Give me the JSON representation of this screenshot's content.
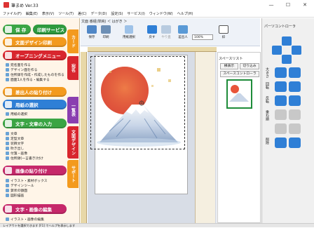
{
  "window": {
    "title": "筆まめ Ver.33",
    "min": "—",
    "max": "☐",
    "close": "✕"
  },
  "menu": [
    "ファイル(F)",
    "編集(E)",
    "表示(V)",
    "ツール(T)",
    "差(C)",
    "データ(D)",
    "設定(S)",
    "サービス(I)",
    "ウィンドウ(W)",
    "ヘルプ(H)"
  ],
  "sidebar": {
    "save_label": "保 存",
    "print_service_label": "印刷サービス",
    "design_print_label": "文面デザイン印刷",
    "opening_menu_label": "オープニングメニュー",
    "opening_items": [
      "宛名面を作る",
      "デザイン面を作る",
      "住所録を作成・作成したものを作る",
      "面面1人を作る・編集する"
    ],
    "paste_label": "差出人の貼り付け",
    "paper_select_label": "用紙の選択",
    "paper_select_item": "用紙の選択",
    "text_insert_label": "文字・文章の入力",
    "text_items": [
      "文章",
      "定型文章",
      "装飾文字",
      "吹き出し",
      "付箋・画像",
      "住所録(一言書き)付け"
    ],
    "image_paste_label": "画像の貼り付け",
    "image_items": [
      "イラスト・素材ボックス",
      "デザインツール",
      "賀状の額面",
      "図形描画"
    ],
    "edit_label": "文字・画像の編集",
    "edit_item": "イラスト・画像の編集",
    "vtabs": [
      "カード",
      "宛名",
      "一覧表",
      "文面デザイン",
      "サポート"
    ]
  },
  "toolbar": {
    "tab_title": "文面 番組(単純) ＜ はがき ＞",
    "buttons": [
      "保存",
      "印刷",
      "用紙選択",
      "戻す",
      "やり直",
      "差出人",
      "枠"
    ],
    "zoom": "100%"
  },
  "midpanel": {
    "header": "スペースリスト",
    "btn_front": "横表示",
    "btn_crop": "切り込み",
    "btn_remote": "スペースコントローラ"
  },
  "rpanel": {
    "title": "パーツコントローラ",
    "labels": [
      "大きさ",
      "回転",
      "反転",
      "重ね順",
      "削除"
    ]
  },
  "statusbar": "レイアウトを選択できます [F1] でヘルプを表示します",
  "colors": {
    "orange": "#f39a1e",
    "red": "#d8262e",
    "green": "#3aa544",
    "purple": "#8a3fb0",
    "blue": "#2f7fd6",
    "magenta": "#c6286a",
    "olive": "#8aa02a"
  }
}
